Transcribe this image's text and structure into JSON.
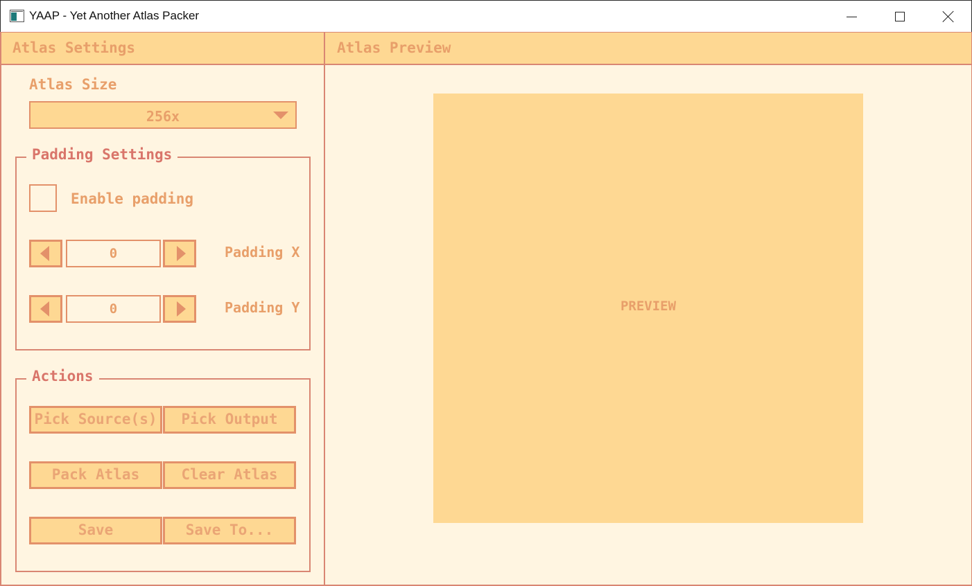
{
  "window": {
    "title": "YAAP - Yet Another Atlas Packer",
    "icons": [
      "app-icon",
      "minimize-icon",
      "maximize-icon",
      "close-icon"
    ]
  },
  "settings_panel": {
    "title": "Atlas Settings",
    "atlas_size": {
      "label": "Atlas Size",
      "selected": "256x"
    },
    "padding_group": {
      "title": "Padding Settings",
      "enable_label": "Enable padding",
      "enabled": false,
      "padding_x": {
        "value": "0",
        "label": "Padding X"
      },
      "padding_y": {
        "value": "0",
        "label": "Padding Y"
      }
    },
    "actions_group": {
      "title": "Actions",
      "buttons": [
        "Pick Source(s)",
        "Pick Output",
        "Pack Atlas",
        "Clear Atlas",
        "Save",
        "Save To..."
      ]
    }
  },
  "preview_panel": {
    "title": "Atlas Preview",
    "placeholder": "PREVIEW"
  },
  "colors": {
    "background": "#fff5e1",
    "accent_fill": "#fed893",
    "border": "#d98673",
    "text": "#e89f6a"
  }
}
